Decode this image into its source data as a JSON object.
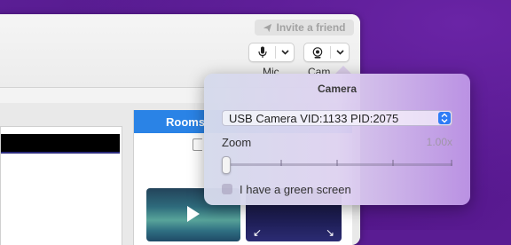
{
  "toolbar": {
    "invite_label": "Invite a friend",
    "mic_label": "Mic",
    "camera_label": "Cam"
  },
  "rooms": {
    "header": "Rooms"
  },
  "camera_popover": {
    "title": "Camera",
    "device_selected": "USB Camera VID:1133 PID:2075",
    "zoom_label": "Zoom",
    "zoom_value": "1.00x",
    "zoom_level": 0,
    "green_screen_label": "I have a green screen",
    "green_screen_checked": false
  },
  "colors": {
    "desktop_bg": "#5a1c93",
    "accent_blue": "#2a83e6",
    "select_stepper": "#2e7cf6"
  },
  "icons": [
    "send-icon",
    "microphone-icon",
    "webcam-icon",
    "chevron-down-icon",
    "play-icon",
    "expand-icon"
  ]
}
